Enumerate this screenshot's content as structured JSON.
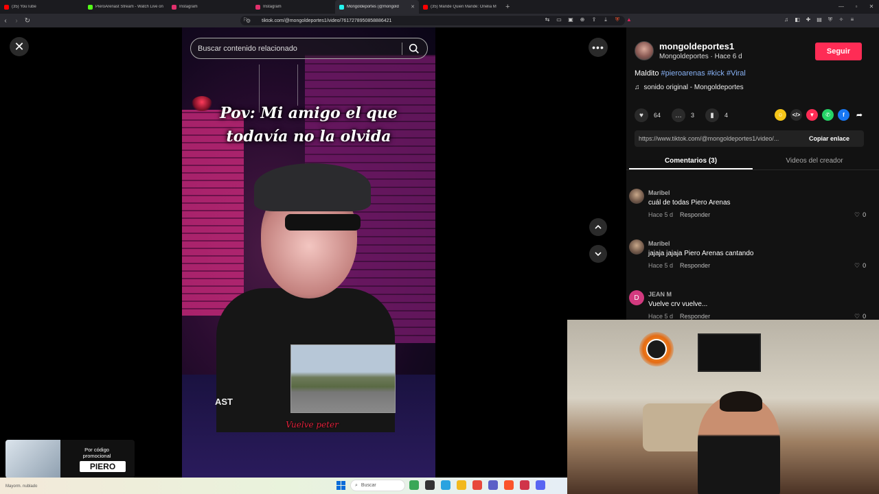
{
  "browser": {
    "tabs": [
      {
        "label": "(35) YouTube",
        "color": "#ff0000",
        "active": false
      },
      {
        "label": "PieroArenast Stream - Watch Live on",
        "color": "#53fc18",
        "active": false
      },
      {
        "label": "Instagram",
        "color": "#e1306c",
        "active": false
      },
      {
        "label": "Instagram",
        "color": "#e1306c",
        "active": false
      },
      {
        "label": "Mongoldeportes (@mongold",
        "color": "#25f4ee",
        "active": true
      },
      {
        "label": "(35) Mande Quien Mande: Onelia M",
        "color": "#ff0000",
        "active": false
      }
    ],
    "url": "tiktok.com/@mongoldeportes1/video/7617278950858886421"
  },
  "video": {
    "search_placeholder": "Buscar contenido relacionado",
    "overlay_line1": "Pov: Mi amigo el que",
    "overlay_line2": "todavía no la olvida",
    "caption": "Vuelve peter",
    "watermark": "AST"
  },
  "creator": {
    "username": "mongoldeportes1",
    "subline": "Mongoldeportes · Hace 6 d",
    "follow_label": "Seguir",
    "description_prefix": "Maldito ",
    "hashtags": [
      "#pieroarenas",
      "#kick",
      "#Viral"
    ],
    "sound": "sonido original - Mongoldeportes"
  },
  "stats": {
    "likes": "64",
    "comments": "3",
    "saves": "4"
  },
  "share_icons": [
    {
      "name": "coin-icon",
      "color": "#f5c518",
      "glyph": "☺"
    },
    {
      "name": "embed-icon",
      "color": "#2a2a2a",
      "glyph": "</>"
    },
    {
      "name": "send-icon",
      "color": "#fe2c55",
      "glyph": "▼"
    },
    {
      "name": "whatsapp-icon",
      "color": "#25d366",
      "glyph": "✆"
    },
    {
      "name": "facebook-icon",
      "color": "#1877f2",
      "glyph": "f"
    },
    {
      "name": "share-arrow-icon",
      "color": "#121212",
      "glyph": "➦"
    }
  ],
  "link": {
    "url": "https://www.tiktok.com/@mongoldeportes1/video/...",
    "copy_label": "Copiar enlace"
  },
  "panel_tabs": {
    "comments": "Comentarios (3)",
    "creator_videos": "Videos del creador"
  },
  "comments": [
    {
      "name": "Maribel",
      "text": "cuál de todas Piero Arenas",
      "time": "Hace 5 d",
      "reply": "Responder",
      "likes": "0",
      "letter": ""
    },
    {
      "name": "Maribel",
      "text": "jajaja jajaja Piero Arenas cantando",
      "time": "Hace 5 d",
      "reply": "Responder",
      "likes": "0",
      "letter": ""
    },
    {
      "name": "JEAN M",
      "text": "Vuelve crv vuelve...",
      "time": "Hace 5 d",
      "reply": "Responder",
      "likes": "0",
      "letter": "D"
    }
  ],
  "promo": {
    "line": "Por código promocional",
    "code": "PIERO"
  },
  "taskbar": {
    "weather": "Mayorm. nublado",
    "search": "Buscar"
  }
}
